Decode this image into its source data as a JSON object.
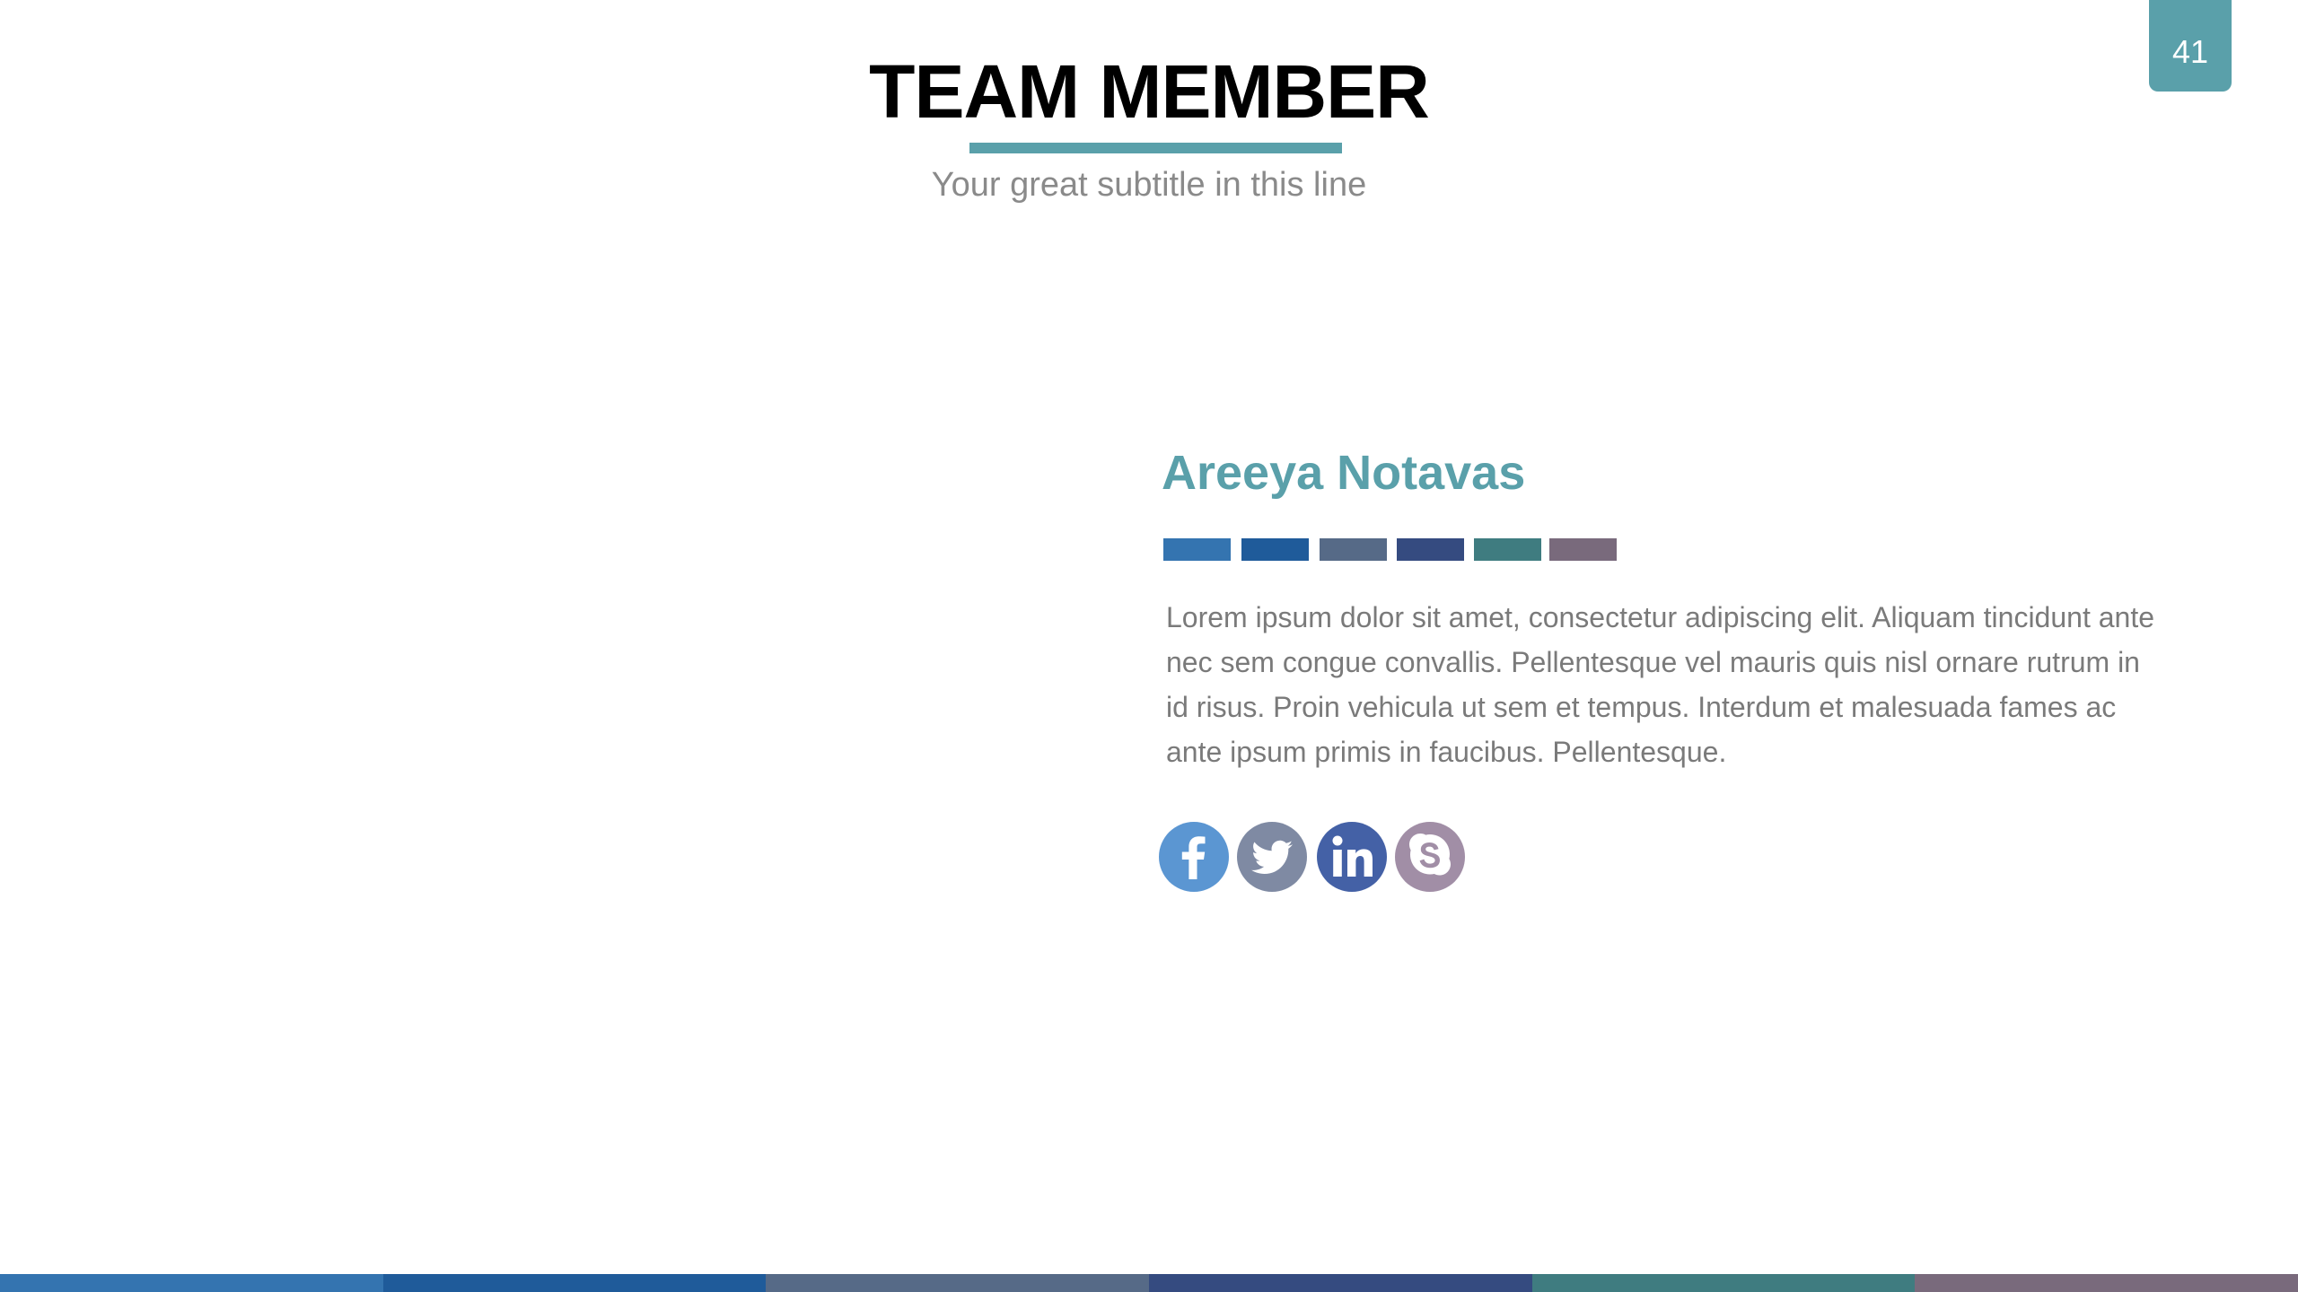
{
  "slide": {
    "title": "TEAM MEMBER",
    "subtitle": "Your great subtitle in this line",
    "page_number": "41",
    "accent_color": "#5aa0aa"
  },
  "member": {
    "name": "Areeya Notavas",
    "bio": "Lorem ipsum dolor sit amet, consectetur adipiscing elit. Aliquam tincidunt ante nec sem congue convallis. Pellentesque vel mauris quis nisl ornare rutrum in id risus. Proin vehicula ut sem et tempus. Interdum et malesuada fames ac ante ipsum primis in faucibus. Pellentesque."
  },
  "palette": [
    "#3474b0",
    "#1f5b9a",
    "#566a87",
    "#354b80",
    "#3f7c80",
    "#796a7c"
  ],
  "social": [
    {
      "icon": "facebook-icon",
      "color": "#5b96d2"
    },
    {
      "icon": "twitter-icon",
      "color": "#7f8aa3"
    },
    {
      "icon": "linkedin-icon",
      "color": "#4461a6"
    },
    {
      "icon": "skype-icon",
      "color": "#a18ea6"
    }
  ]
}
